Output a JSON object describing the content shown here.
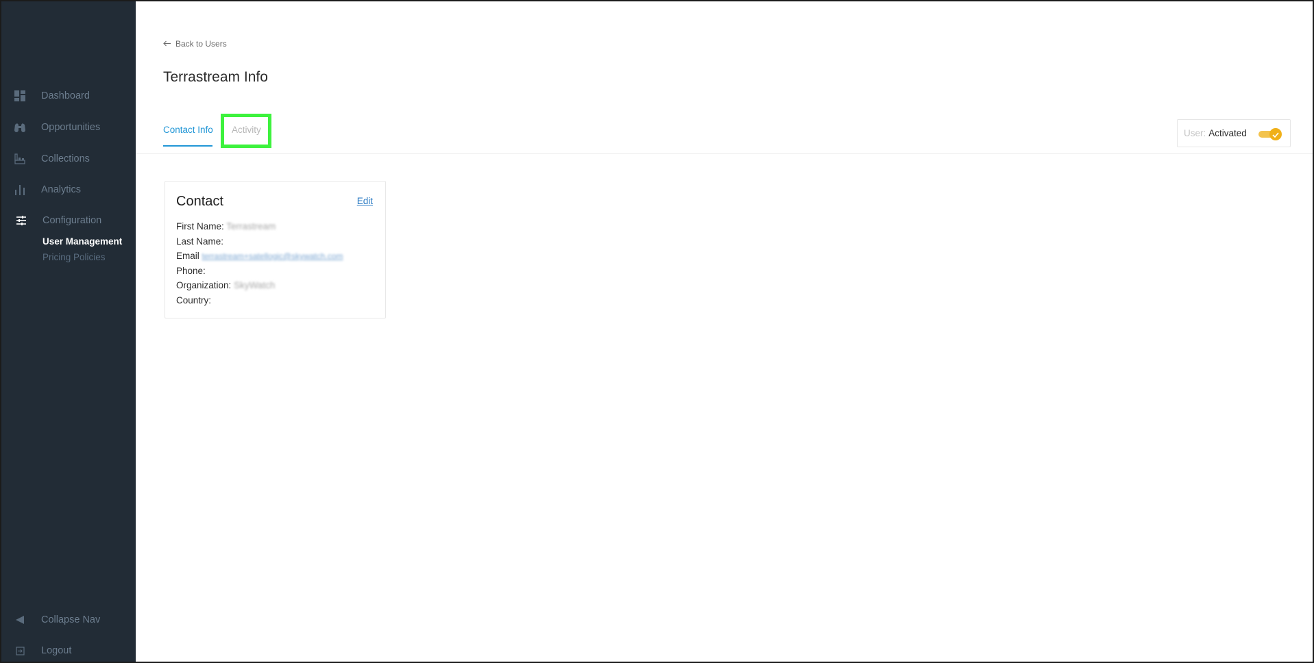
{
  "sidebar": {
    "items": [
      {
        "label": "Dashboard",
        "icon": "dashboard-icon"
      },
      {
        "label": "Opportunities",
        "icon": "binoculars-icon"
      },
      {
        "label": "Collections",
        "icon": "collections-icon"
      },
      {
        "label": "Analytics",
        "icon": "bar-chart-icon"
      },
      {
        "label": "Configuration",
        "icon": "sliders-icon"
      }
    ],
    "subitems": [
      {
        "label": "User Management",
        "active": true
      },
      {
        "label": "Pricing Policies",
        "active": false
      }
    ],
    "collapse_label": "Collapse Nav",
    "logout_label": "Logout"
  },
  "header": {
    "back_label": "Back to Users",
    "title": "Terrastream Info"
  },
  "tabs": [
    {
      "label": "Contact Info",
      "active": true
    },
    {
      "label": "Activity",
      "active": false
    }
  ],
  "status": {
    "prefix": "User:",
    "value": "Activated",
    "enabled": true
  },
  "contact": {
    "title": "Contact",
    "edit_label": "Edit",
    "fields": [
      {
        "label": "First Name:",
        "value": "Terrastream"
      },
      {
        "label": "Last Name:",
        "value": ""
      },
      {
        "label": "Email",
        "value": "terrastream+satellogic@skywatch.com"
      },
      {
        "label": "Phone:",
        "value": ""
      },
      {
        "label": "Organization:",
        "value": "SkyWatch"
      },
      {
        "label": "Country:",
        "value": ""
      }
    ]
  },
  "colors": {
    "sidebar_bg": "#222c36",
    "accent": "#2196d6",
    "toggle": "#f0b019",
    "highlight": "#3df23d"
  }
}
